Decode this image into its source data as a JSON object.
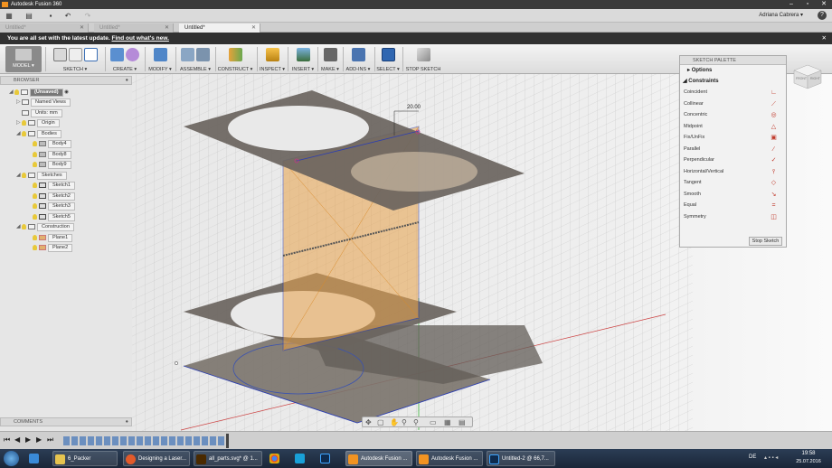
{
  "window": {
    "title": "Autodesk Fusion 360"
  },
  "quickbar": {
    "user_name": "Adriana Cabrera ▾",
    "help": "?"
  },
  "doc_tabs": [
    {
      "label": "Untitled*",
      "active": false
    },
    {
      "label": "Untitled*",
      "active": false
    },
    {
      "label": "Untitled*",
      "active": true
    }
  ],
  "banner": {
    "message": "You are all set with the latest update.",
    "link": "Find out what's new."
  },
  "ribbon": {
    "model": "MODEL ▾",
    "groups": [
      "SKETCH ▾",
      "CREATE ▾",
      "MODIFY ▾",
      "ASSEMBLE ▾",
      "CONSTRUCT ▾",
      "INSPECT ▾",
      "INSERT ▾",
      "MAKE ▾",
      "ADD-INS ▾",
      "SELECT ▾",
      "STOP SKETCH"
    ]
  },
  "browser": {
    "title": "BROWSER",
    "tree": [
      {
        "label": "(Unsaved)",
        "depth": 0
      },
      {
        "label": "Named Views",
        "depth": 1
      },
      {
        "label": "Units: mm",
        "depth": 1
      },
      {
        "label": "Origin",
        "depth": 1
      },
      {
        "label": "Bodies",
        "depth": 1
      },
      {
        "label": "Body4",
        "depth": 2
      },
      {
        "label": "Body8",
        "depth": 2
      },
      {
        "label": "Body9",
        "depth": 2
      },
      {
        "label": "Sketches",
        "depth": 1
      },
      {
        "label": "Sketch1",
        "depth": 2
      },
      {
        "label": "Sketch2",
        "depth": 2
      },
      {
        "label": "Sketch3",
        "depth": 2
      },
      {
        "label": "Sketch5",
        "depth": 2
      },
      {
        "label": "Construction",
        "depth": 1
      },
      {
        "label": "Plane1",
        "depth": 2
      },
      {
        "label": "Plane2",
        "depth": 2
      }
    ]
  },
  "comments": {
    "title": "COMMENTS"
  },
  "palette": {
    "title": "SKETCH PALETTE",
    "options_label": "Options",
    "constraints_label": "Constraints",
    "constraints": [
      "Coincident",
      "Collinear",
      "Concentric",
      "Midpoint",
      "Fix/UnFix",
      "Parallel",
      "Perpendicular",
      "Horizontal/Vertical",
      "Tangent",
      "Smooth",
      "Equal",
      "Symmetry"
    ],
    "stop_button": "Stop Sketch"
  },
  "viewport": {
    "dimension": "20.00"
  },
  "viewcube": {
    "left": "FRONT",
    "right": "RIGHT"
  },
  "taskbar": {
    "items": [
      "6_Packer",
      "Designing a Laser...",
      "all_parts.svg* @ 1...",
      "Autodesk Fusion ...",
      "Autodesk Fusion ...",
      "Untitled-2 @ 66,7..."
    ],
    "language": "DE",
    "time": "19:58",
    "date": "25.07.2016"
  },
  "colors": {
    "accent": "#f29321",
    "banner_bg": "#313131",
    "sketch_plane": "#e8a24a",
    "body": "#6e665e"
  }
}
